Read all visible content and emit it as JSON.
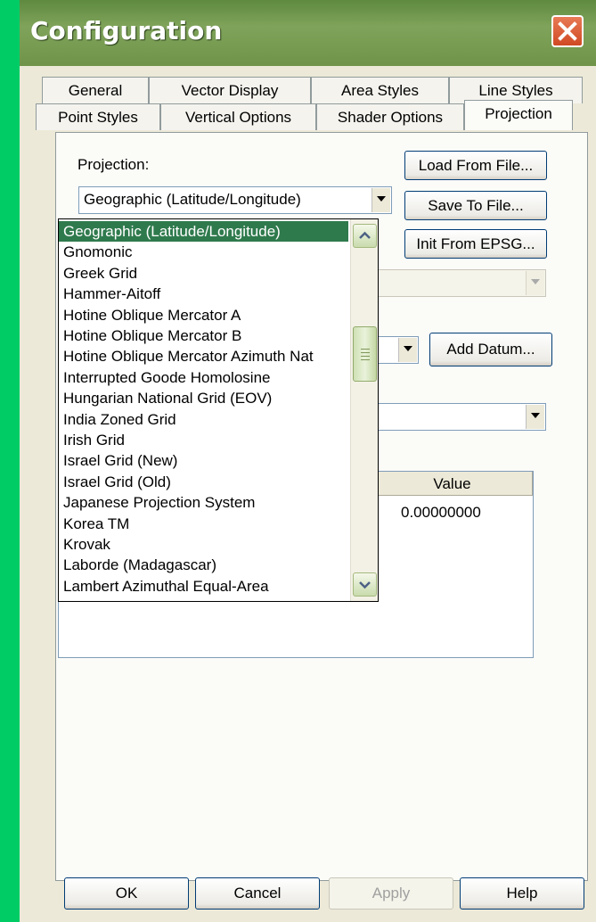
{
  "window": {
    "title": "Configuration"
  },
  "tabs_row1": [
    "General",
    "Vector Display",
    "Area Styles",
    "Line Styles"
  ],
  "tabs_row2": [
    "Point Styles",
    "Vertical Options",
    "Shader Options",
    "Projection"
  ],
  "projection": {
    "label": "Projection:",
    "selected": "Geographic (Latitude/Longitude)",
    "load_button": "Load From File...",
    "save_button": "Save To File...",
    "init_button": "Init From EPSG...",
    "add_datum_button": "Add Datum..."
  },
  "dropdown_items": [
    "Geographic (Latitude/Longitude)",
    "Gnomonic",
    "Greek Grid",
    "Hammer-Aitoff",
    "Hotine Oblique Mercator A",
    "Hotine Oblique Mercator B",
    "Hotine Oblique Mercator Azimuth Nat",
    "Interrupted Goode Homolosine",
    "Hungarian National Grid (EOV)",
    "India Zoned Grid",
    "Irish Grid",
    "Israel Grid (New)",
    "Israel Grid (Old)",
    "Japanese Projection System",
    "Korea TM",
    "Krovak",
    "Laborde (Madagascar)",
    "Lambert Azimuthal Equal-Area"
  ],
  "grid": {
    "value_header": "Value",
    "value": "0.00000000"
  },
  "footer": {
    "ok": "OK",
    "cancel": "Cancel",
    "apply": "Apply",
    "help": "Help"
  },
  "colors": {
    "titlebar": "#6f9449",
    "selection": "#2f7a4d",
    "background": "#00cc66"
  }
}
